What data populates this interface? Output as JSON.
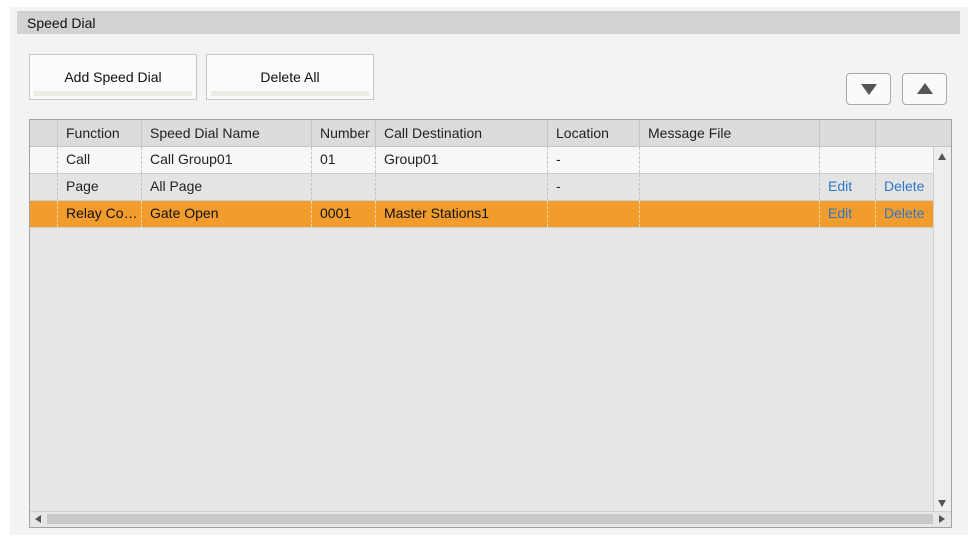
{
  "panel": {
    "title": "Speed Dial"
  },
  "toolbar": {
    "add_label": "Add Speed Dial",
    "delete_all_label": "Delete All",
    "move_down_icon": "triangle-down-icon",
    "move_up_icon": "triangle-up-icon"
  },
  "table": {
    "columns": [
      "",
      "Function",
      "Speed Dial Name",
      "Number",
      "Call Destination",
      "Location",
      "Message File",
      "",
      ""
    ],
    "rows": [
      {
        "function": "Call",
        "name": "Call Group01",
        "number": "01",
        "destination": "Group01",
        "location": "-",
        "message_file": "",
        "edit": "",
        "delete": "",
        "selected": false
      },
      {
        "function": "Page",
        "name": "All Page",
        "number": "",
        "destination": "",
        "location": "-",
        "message_file": "",
        "edit": "Edit",
        "delete": "Delete",
        "selected": false
      },
      {
        "function": "Relay Co…",
        "name": "Gate Open",
        "number": "0001",
        "destination": "Master Stations1",
        "location": "",
        "message_file": "",
        "edit": "Edit",
        "delete": "Delete",
        "selected": true
      }
    ]
  },
  "colors": {
    "selected_row": "#f29c2e",
    "link": "#2d78c6",
    "header_bar": "#d2d2d2"
  }
}
